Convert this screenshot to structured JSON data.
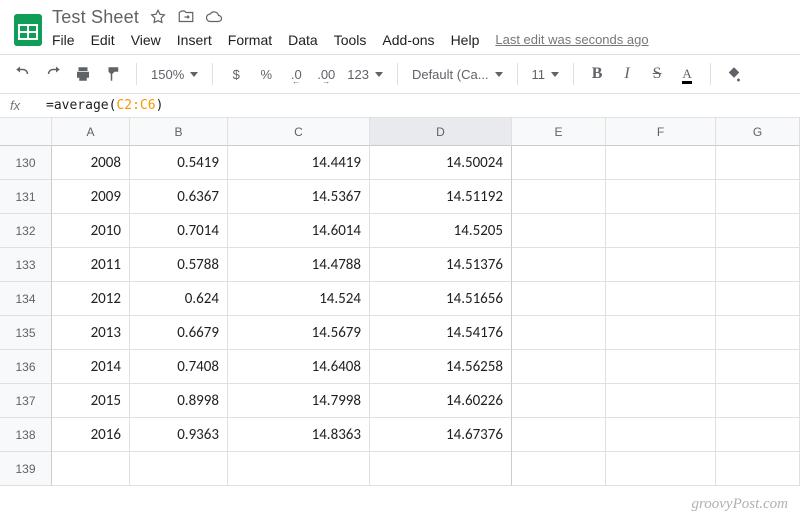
{
  "doc": {
    "title": "Test Sheet"
  },
  "menu": {
    "file": "File",
    "edit": "Edit",
    "view": "View",
    "insert": "Insert",
    "format": "Format",
    "data": "Data",
    "tools": "Tools",
    "addons": "Add-ons",
    "help": "Help",
    "last_edit": "Last edit was seconds ago"
  },
  "toolbar": {
    "zoom": "150%",
    "currency": "$",
    "percent": "%",
    "dec_dec": ".0",
    "dec_inc": ".00",
    "num_fmt": "123",
    "font": "Default (Ca...",
    "font_size": "11",
    "bold": "B",
    "italic": "I",
    "strike": "S",
    "color": "A"
  },
  "formula": {
    "fx": "fx",
    "prefix": "=average(",
    "ref": "C2:C6",
    "suffix": ")"
  },
  "columns": [
    "A",
    "B",
    "C",
    "D",
    "E",
    "F",
    "G"
  ],
  "selected_col": "D",
  "rows": [
    {
      "n": "130",
      "A": "2008",
      "B": "0.5419",
      "C": "14.4419",
      "D": "14.50024",
      "E": "",
      "F": "",
      "G": ""
    },
    {
      "n": "131",
      "A": "2009",
      "B": "0.6367",
      "C": "14.5367",
      "D": "14.51192",
      "E": "",
      "F": "",
      "G": ""
    },
    {
      "n": "132",
      "A": "2010",
      "B": "0.7014",
      "C": "14.6014",
      "D": "14.5205",
      "E": "",
      "F": "",
      "G": ""
    },
    {
      "n": "133",
      "A": "2011",
      "B": "0.5788",
      "C": "14.4788",
      "D": "14.51376",
      "E": "",
      "F": "",
      "G": ""
    },
    {
      "n": "134",
      "A": "2012",
      "B": "0.624",
      "C": "14.524",
      "D": "14.51656",
      "E": "",
      "F": "",
      "G": ""
    },
    {
      "n": "135",
      "A": "2013",
      "B": "0.6679",
      "C": "14.5679",
      "D": "14.54176",
      "E": "",
      "F": "",
      "G": ""
    },
    {
      "n": "136",
      "A": "2014",
      "B": "0.7408",
      "C": "14.6408",
      "D": "14.56258",
      "E": "",
      "F": "",
      "G": ""
    },
    {
      "n": "137",
      "A": "2015",
      "B": "0.8998",
      "C": "14.7998",
      "D": "14.60226",
      "E": "",
      "F": "",
      "G": ""
    },
    {
      "n": "138",
      "A": "2016",
      "B": "0.9363",
      "C": "14.8363",
      "D": "14.67376",
      "E": "",
      "F": "",
      "G": ""
    },
    {
      "n": "139",
      "A": "",
      "B": "",
      "C": "",
      "D": "",
      "E": "",
      "F": "",
      "G": ""
    }
  ],
  "watermark": "groovyPost.com"
}
